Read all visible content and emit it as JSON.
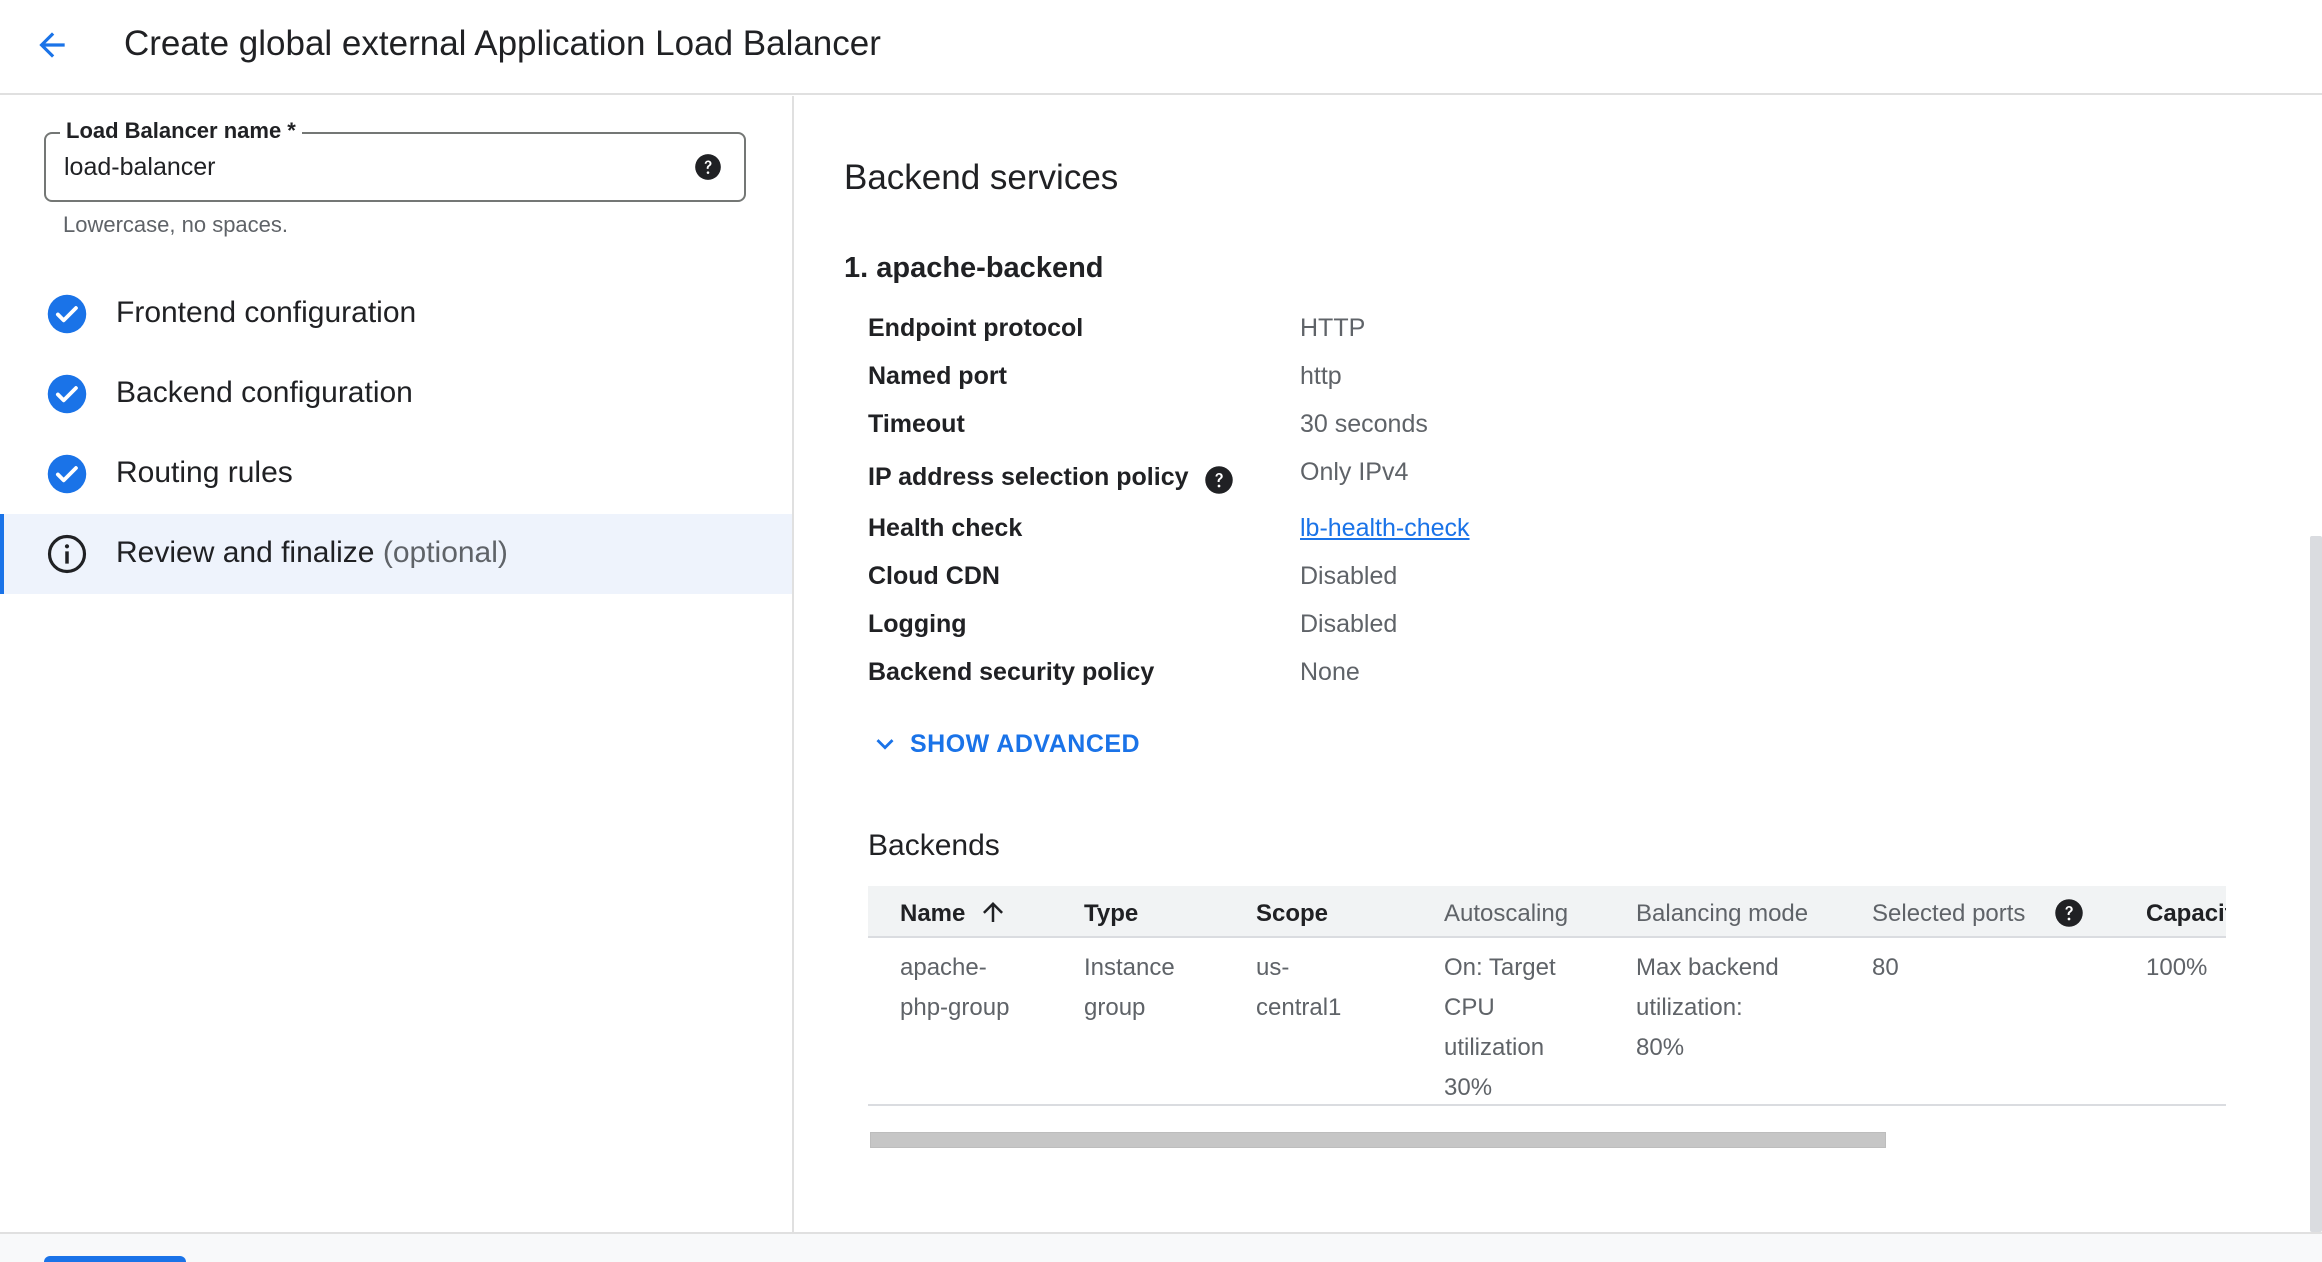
{
  "header": {
    "back_icon": "arrow-back-icon",
    "title": "Create global external Application Load Balancer"
  },
  "name_field": {
    "label": "Load Balancer name *",
    "value": "load-balancer",
    "hint": "Lowercase, no spaces.",
    "help_icon": "help-icon"
  },
  "steps": [
    {
      "label": "Frontend configuration",
      "optional": "",
      "status": "complete",
      "icon": "check-circle-icon"
    },
    {
      "label": "Backend configuration",
      "optional": "",
      "status": "complete",
      "icon": "check-circle-icon"
    },
    {
      "label": "Routing rules",
      "optional": "",
      "status": "complete",
      "icon": "check-circle-icon"
    },
    {
      "label": "Review and finalize",
      "optional": "(optional)",
      "status": "active",
      "icon": "info-icon"
    }
  ],
  "main": {
    "section_title": "Backend services",
    "backend_title": "1. apache-backend",
    "properties": [
      {
        "key": "Endpoint protocol",
        "value": "HTTP"
      },
      {
        "key": "Named port",
        "value": "http"
      },
      {
        "key": "Timeout",
        "value": "30 seconds"
      },
      {
        "key": "IP address selection policy",
        "value": "Only IPv4"
      },
      {
        "key": "Health check",
        "value": "lb-health-check"
      },
      {
        "key": "Cloud CDN",
        "value": "Disabled"
      },
      {
        "key": "Logging",
        "value": "Disabled"
      },
      {
        "key": "Backend security policy",
        "value": "None"
      }
    ],
    "show_advanced": "SHOW ADVANCED",
    "backends_title": "Backends",
    "table": {
      "columns": [
        "Name",
        "Type",
        "Scope",
        "Autoscaling",
        "Balancing mode",
        "Selected ports",
        "Capacit"
      ],
      "rows": [
        {
          "name": [
            "apache-",
            "php-group"
          ],
          "type": [
            "Instance",
            "group"
          ],
          "scope": [
            "us-",
            "central1"
          ],
          "autoscaling": [
            "On: Target",
            "CPU",
            "utilization",
            "30%"
          ],
          "balancing_mode": [
            "Max backend",
            "utilization:",
            "80%"
          ],
          "selected_ports": [
            "80"
          ],
          "capacity": [
            "100%"
          ]
        }
      ]
    }
  },
  "colors": {
    "accent": "#1a73e8",
    "active_step_bg": "#eef3fc",
    "text_primary": "#202124",
    "text_secondary": "#5f6368"
  }
}
